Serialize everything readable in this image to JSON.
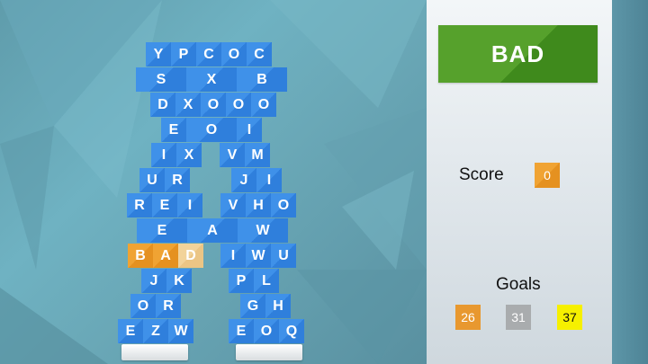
{
  "current_word": "BAD",
  "score_label": "Score",
  "score_value": "0",
  "goals_label": "Goals",
  "goals": [
    {
      "value": "26",
      "color": "#e8982f",
      "text_color": "#ffffff"
    },
    {
      "value": "31",
      "color": "#a9acae",
      "text_color": "#ffffff"
    },
    {
      "value": "37",
      "color": "#f6f000",
      "text_color": "#111111"
    }
  ],
  "colors": {
    "tile_blue": "#3a8ae6",
    "tile_selected": "#f0a333",
    "tile_selected_light": "#f2d39a",
    "word_box_green": "#4f9a26"
  },
  "tiles": [
    {
      "letter": "Y",
      "state": "normal"
    },
    {
      "letter": "P",
      "state": "normal"
    },
    {
      "letter": "C",
      "state": "normal"
    },
    {
      "letter": "O",
      "state": "normal"
    },
    {
      "letter": "C",
      "state": "normal"
    },
    {
      "letter": "S",
      "state": "normal"
    },
    {
      "letter": "",
      "state": "normal"
    },
    {
      "letter": "X",
      "state": "normal"
    },
    {
      "letter": "",
      "state": "normal"
    },
    {
      "letter": "B",
      "state": "normal"
    },
    {
      "letter": "D",
      "state": "normal"
    },
    {
      "letter": "X",
      "state": "normal"
    },
    {
      "letter": "O",
      "state": "normal"
    },
    {
      "letter": "O",
      "state": "normal"
    },
    {
      "letter": "O",
      "state": "normal"
    },
    {
      "letter": "E",
      "state": "normal"
    },
    {
      "letter": "O",
      "state": "normal"
    },
    {
      "letter": "I",
      "state": "normal"
    },
    {
      "letter": "I",
      "state": "normal"
    },
    {
      "letter": "X",
      "state": "normal"
    },
    {
      "letter": "V",
      "state": "normal"
    },
    {
      "letter": "M",
      "state": "normal"
    },
    {
      "letter": "U",
      "state": "normal"
    },
    {
      "letter": "R",
      "state": "normal"
    },
    {
      "letter": "J",
      "state": "normal"
    },
    {
      "letter": "I",
      "state": "normal"
    },
    {
      "letter": "R",
      "state": "normal"
    },
    {
      "letter": "E",
      "state": "normal"
    },
    {
      "letter": "I",
      "state": "normal"
    },
    {
      "letter": "V",
      "state": "normal"
    },
    {
      "letter": "H",
      "state": "normal"
    },
    {
      "letter": "O",
      "state": "normal"
    },
    {
      "letter": "E",
      "state": "normal"
    },
    {
      "letter": "A",
      "state": "normal"
    },
    {
      "letter": "W",
      "state": "normal"
    },
    {
      "letter": "B",
      "state": "selected"
    },
    {
      "letter": "A",
      "state": "selected"
    },
    {
      "letter": "D",
      "state": "selected-light"
    },
    {
      "letter": "I",
      "state": "normal"
    },
    {
      "letter": "W",
      "state": "normal"
    },
    {
      "letter": "U",
      "state": "normal"
    },
    {
      "letter": "J",
      "state": "normal"
    },
    {
      "letter": "K",
      "state": "normal"
    },
    {
      "letter": "P",
      "state": "normal"
    },
    {
      "letter": "L",
      "state": "normal"
    },
    {
      "letter": "O",
      "state": "normal"
    },
    {
      "letter": "R",
      "state": "normal"
    },
    {
      "letter": "G",
      "state": "normal"
    },
    {
      "letter": "H",
      "state": "normal"
    },
    {
      "letter": "E",
      "state": "normal"
    },
    {
      "letter": "Z",
      "state": "normal"
    },
    {
      "letter": "W",
      "state": "normal"
    },
    {
      "letter": "E",
      "state": "normal"
    },
    {
      "letter": "O",
      "state": "normal"
    },
    {
      "letter": "Q",
      "state": "normal"
    }
  ]
}
